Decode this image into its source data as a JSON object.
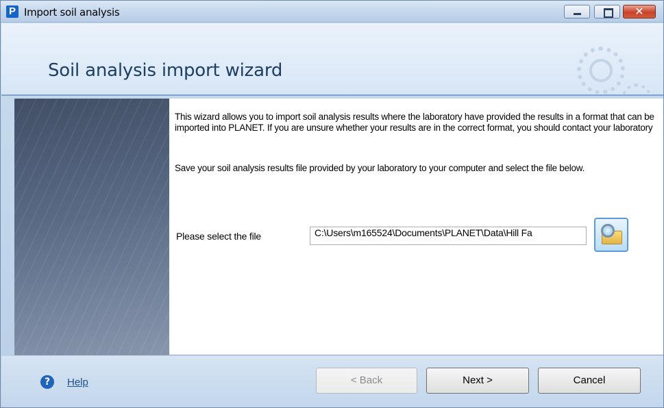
{
  "window": {
    "title": "Import soil analysis",
    "app_icon_letter": "P",
    "close_glyph": "✕"
  },
  "header": {
    "title": "Soil analysis import wizard"
  },
  "content": {
    "intro": "This wizard allows you to import soil analysis results where the laboratory have provided the results in a format that can be imported into PLANET. If you are unsure whether your results are in the correct format, you should contact your laboratory",
    "instruction": "Save your soil analysis results file provided by your laboratory to your computer and select the file below.",
    "file_label": "Please select the file",
    "file_path": "C:\\Users\\m165524\\Documents\\PLANET\\Data\\Hill Fa"
  },
  "footer": {
    "help_glyph": "?",
    "help_label": "Help",
    "back_label": "< Back",
    "next_label": "Next >",
    "cancel_label": "Cancel"
  },
  "colors": {
    "accent": "#1e3f63",
    "side_panel": "#4a5872",
    "link": "#1b4f8f"
  },
  "icons": [
    "app-icon",
    "minimize-icon",
    "maximize-icon",
    "close-icon",
    "gear-icon",
    "browse-folder-icon",
    "help-icon"
  ]
}
